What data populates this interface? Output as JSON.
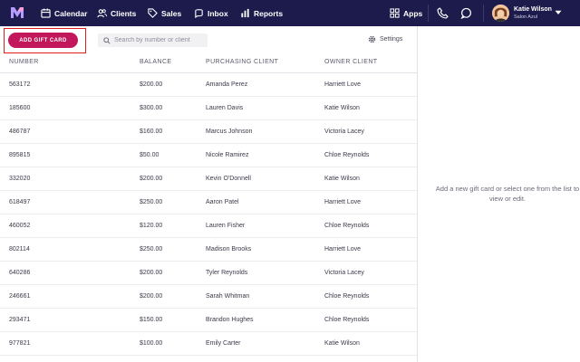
{
  "nav": {
    "items": [
      {
        "label": "Calendar",
        "icon": "calendar-icon"
      },
      {
        "label": "Clients",
        "icon": "clients-icon"
      },
      {
        "label": "Sales",
        "icon": "tag-icon"
      },
      {
        "label": "Inbox",
        "icon": "inbox-icon"
      },
      {
        "label": "Reports",
        "icon": "bar-chart-icon"
      }
    ],
    "apps_label": "Apps",
    "user_name": "Katie Wilson",
    "user_location": "Salon Azul"
  },
  "toolbar": {
    "add_label": "ADD GIFT CARD",
    "search_placeholder": "Search by number or client",
    "settings_label": "Settings"
  },
  "table": {
    "headers": [
      "NUMBER",
      "BALANCE",
      "PURCHASING CLIENT",
      "OWNER CLIENT"
    ],
    "rows": [
      [
        "563172",
        "$200.00",
        "Amanda Perez",
        "Harriett Love"
      ],
      [
        "185600",
        "$300.00",
        "Lauren Davis",
        "Katie Wilson"
      ],
      [
        "486787",
        "$160.00",
        "Marcus Johnson",
        "Victoria Lacey"
      ],
      [
        "895815",
        "$50.00",
        "Nicole Ramirez",
        "Chloe Reynolds"
      ],
      [
        "332020",
        "$200.00",
        "Kevin O'Donnell",
        "Katie Wilson"
      ],
      [
        "618497",
        "$250.00",
        "Aaron Patel",
        "Harriett Love"
      ],
      [
        "460052",
        "$120.00",
        "Lauren Fisher",
        "Chloe Reynolds"
      ],
      [
        "802114",
        "$250.00",
        "Madison Brooks",
        "Harriett Love"
      ],
      [
        "640286",
        "$200.00",
        "Tyler Reynolds",
        "Victoria Lacey"
      ],
      [
        "246661",
        "$200.00",
        "Sarah Whitman",
        "Chloe Reynolds"
      ],
      [
        "293471",
        "$150.00",
        "Brandon Hughes",
        "Chloe Reynolds"
      ],
      [
        "977821",
        "$100.00",
        "Emily Carter",
        "Katie Wilson"
      ]
    ]
  },
  "detail": {
    "empty_message": "Add a new gift card or select one from the list to view or edit."
  },
  "colors": {
    "nav_bg": "#1c1b4b",
    "accent": "#c2185b",
    "highlight": "#e01e1e"
  }
}
